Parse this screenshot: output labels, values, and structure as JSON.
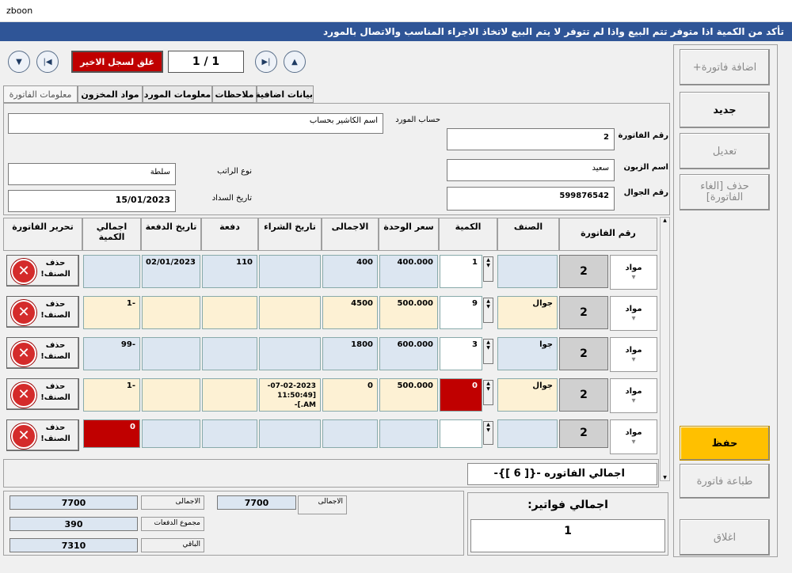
{
  "window": {
    "title": "zboon"
  },
  "banner": "تأكد من الكمية اذا متوفر تتم البيع واذا لم تتوفر لا يتم البيع لاتخاذ الاجراء المناسب والاتصال بالمورد",
  "nav": {
    "lock_label": "غلق لسجل الاخير",
    "record_counter": "1 / 1"
  },
  "tabs": [
    "بيانات اضافية",
    "ملاحظات",
    "معلومات المورد",
    "مواد المخزون",
    "معلومات الفاتورة"
  ],
  "form": {
    "supplier_account_label": "حساب المورد",
    "supplier_account_value": "اسم الكاشير بحساب",
    "invoice_no_label": "رقم الفاتورة",
    "invoice_no_value": "2",
    "salary_type_label": "نوع الراتب",
    "salary_type_value": "سلطة",
    "customer_name_label": "اسم الزبون",
    "customer_name_value": "سعيد",
    "payment_date_label": "تاريخ السداد",
    "payment_date_value": "15/01/2023",
    "mobile_label": "رقم الجوال",
    "mobile_value": "599876542"
  },
  "grid": {
    "headers": {
      "invoice_no": "رقم الفاتورة",
      "category": "الصنف",
      "quantity": "الكمية",
      "unit_price": "سعر الوحدة",
      "total": "الاجمالى",
      "purchase_date": "تاريخ الشراء",
      "payment": "دفعة",
      "payment_date": "تاريخ الدفعة",
      "total_quantity": "اجمالي الكمية",
      "edit_invoice": "تحرير الفاتورة"
    },
    "type_label": "مواد",
    "delete_label": "حذف الصنف!",
    "rows": [
      {
        "invoice": "2",
        "category": "",
        "qty": "1",
        "price": "400.000",
        "total": "400",
        "purchase_date": "",
        "payment": "110",
        "payment_date": "02/01/2023",
        "total_qty": ""
      },
      {
        "invoice": "2",
        "category": "جوال",
        "qty": "9",
        "price": "500.000",
        "total": "4500",
        "purchase_date": "",
        "payment": "",
        "payment_date": "",
        "total_qty": "-1"
      },
      {
        "invoice": "2",
        "category": "جوا",
        "qty": "3",
        "price": "600.000",
        "total": "1800",
        "purchase_date": "",
        "payment": "",
        "payment_date": "",
        "total_qty": "-99"
      },
      {
        "invoice": "2",
        "category": "جوال",
        "qty": "0",
        "price": "500.000",
        "total": "0",
        "purchase_date": "07-02-2023-\n[11:50:49 AM.]-",
        "payment": "",
        "payment_date": "",
        "total_qty": "-1"
      },
      {
        "invoice": "2",
        "category": "",
        "qty": "",
        "price": "",
        "total": "",
        "purchase_date": "",
        "payment": "",
        "payment_date": "",
        "total_qty": "0"
      }
    ],
    "invoice_total_label": "اجمالي الفاتوره  -{[ 6 ]}-"
  },
  "summary": {
    "total_label": "الاجمالى",
    "total_value": "7700",
    "total_value2": "7700",
    "payments_label": "مجموع الدفعات",
    "payments_value": "390",
    "remaining_label": "الباقي",
    "remaining_value": "7310"
  },
  "invoices_total": {
    "label": ":اجمالي فواتير",
    "value": "1"
  },
  "side_buttons": {
    "add_invoice": "اضافة فاتورة+",
    "new": "جديد",
    "edit": "تعديل",
    "delete_invoice": "حذف [الغاء الفاتورة]",
    "save": "حفظ",
    "print": "طباعة فاتورة",
    "close": "اغلاق"
  },
  "colors": {
    "banner": "#2f5597",
    "save": "#ffc000",
    "alert": "#c00000",
    "row_blue": "#dce6f1",
    "row_cream": "#fdf1d4"
  }
}
